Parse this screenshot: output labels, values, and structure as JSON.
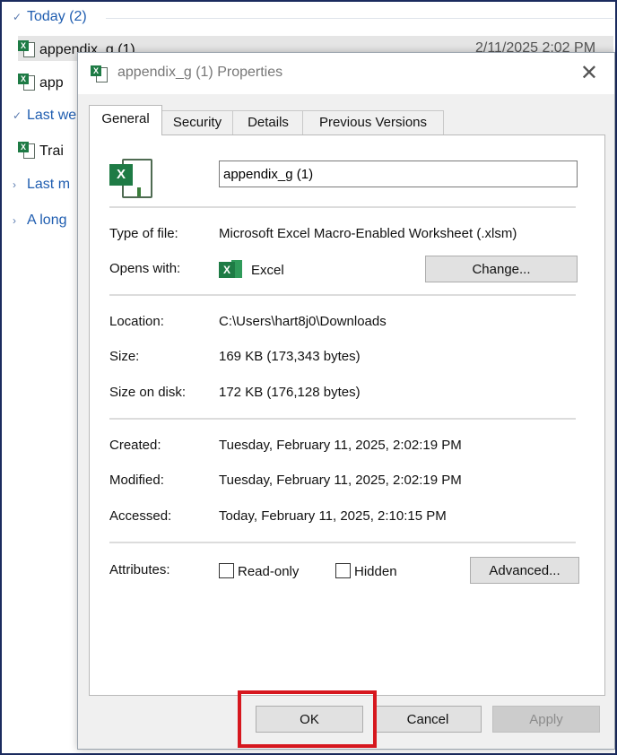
{
  "explorer": {
    "group_today": "Today (2)",
    "row1_name": "appendix_g (1)",
    "row1_date": "2/11/2025 2:02 PM",
    "row2_name": "app",
    "group_last_week": "Last we",
    "row3_name": "Trai",
    "group_last_month": "Last m",
    "group_long_ago": "A long"
  },
  "dialog": {
    "title": "appendix_g (1) Properties",
    "tabs": [
      "General",
      "Security",
      "Details",
      "Previous Versions"
    ],
    "file_name": "appendix_g (1)",
    "type_label": "Type of file:",
    "type_value": "Microsoft Excel Macro-Enabled Worksheet (.xlsm)",
    "opens_label": "Opens with:",
    "opens_value": "Excel",
    "change_button": "Change...",
    "location_label": "Location:",
    "location_value": "C:\\Users\\hart8j0\\Downloads",
    "size_label": "Size:",
    "size_value": "169 KB (173,343 bytes)",
    "size_disk_label": "Size on disk:",
    "size_disk_value": "172 KB (176,128 bytes)",
    "created_label": "Created:",
    "created_value": "Tuesday, February 11, 2025, 2:02:19 PM",
    "modified_label": "Modified:",
    "modified_value": "Tuesday, February 11, 2025, 2:02:19 PM",
    "accessed_label": "Accessed:",
    "accessed_value": "Today, February 11, 2025, 2:10:15 PM",
    "attributes_label": "Attributes:",
    "readonly_label": "Read-only",
    "readonly_checked": false,
    "hidden_label": "Hidden",
    "hidden_checked": false,
    "advanced_button": "Advanced...",
    "ok_button": "OK",
    "cancel_button": "Cancel",
    "apply_button": "Apply",
    "close_glyph": "✕"
  },
  "colors": {
    "excel_green": "#1e7b45",
    "group_blue": "#1f5db0",
    "highlight_red": "#d6171e",
    "frame_navy": "#1b2b5e"
  }
}
